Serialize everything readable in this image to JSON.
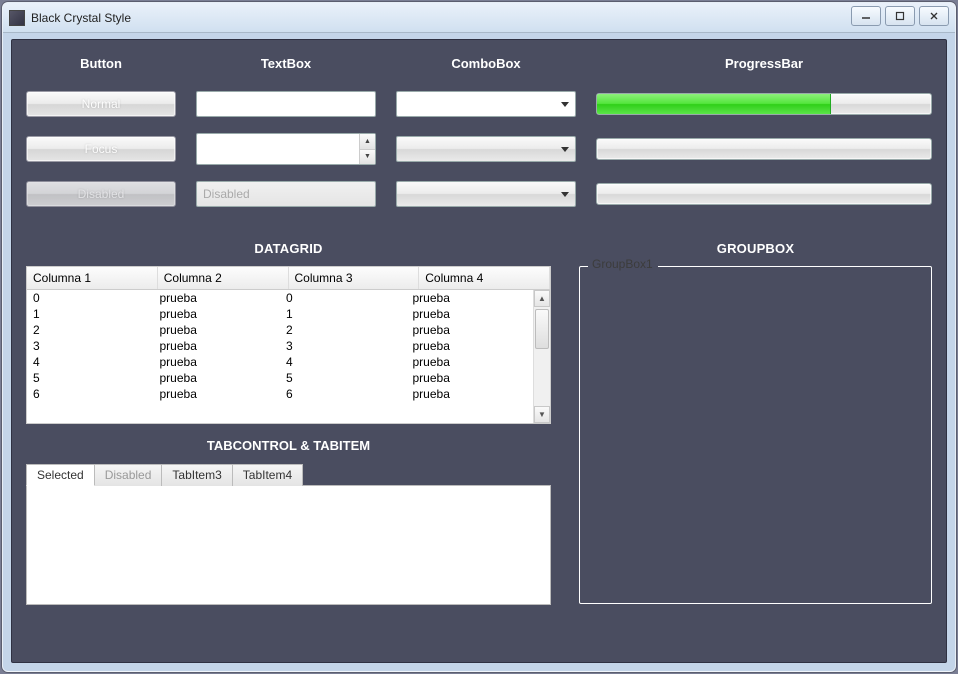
{
  "window": {
    "title": "Black Crystal Style"
  },
  "headers": {
    "button": "Button",
    "textbox": "TextBox",
    "combobox": "ComboBox",
    "progressbar": "ProgressBar"
  },
  "buttons": {
    "normal": "Normal",
    "focus": "Focus",
    "disabled": "Disabled"
  },
  "textboxes": {
    "normal_value": "",
    "numeric_value": "",
    "disabled_placeholder": "Disabled"
  },
  "progress": {
    "value_percent": 70
  },
  "sections": {
    "datagrid": "DATAGRID",
    "groupbox": "GROUPBOX",
    "tabs": "TABCONTROL & TABITEM"
  },
  "datagrid": {
    "columns": [
      "Columna 1",
      "Columna 2",
      "Columna 3",
      "Columna 4"
    ],
    "rows": [
      [
        "0",
        "prueba",
        "0",
        "prueba"
      ],
      [
        "1",
        "prueba",
        "1",
        "prueba"
      ],
      [
        "2",
        "prueba",
        "2",
        "prueba"
      ],
      [
        "3",
        "prueba",
        "3",
        "prueba"
      ],
      [
        "4",
        "prueba",
        "4",
        "prueba"
      ],
      [
        "5",
        "prueba",
        "5",
        "prueba"
      ],
      [
        "6",
        "prueba",
        "6",
        "prueba"
      ]
    ]
  },
  "tabs": {
    "items": [
      {
        "label": "Selected",
        "state": "selected"
      },
      {
        "label": "Disabled",
        "state": "disabled"
      },
      {
        "label": "TabItem3",
        "state": "normal"
      },
      {
        "label": "TabItem4",
        "state": "normal"
      }
    ]
  },
  "groupbox": {
    "legend": "GroupBox1"
  }
}
